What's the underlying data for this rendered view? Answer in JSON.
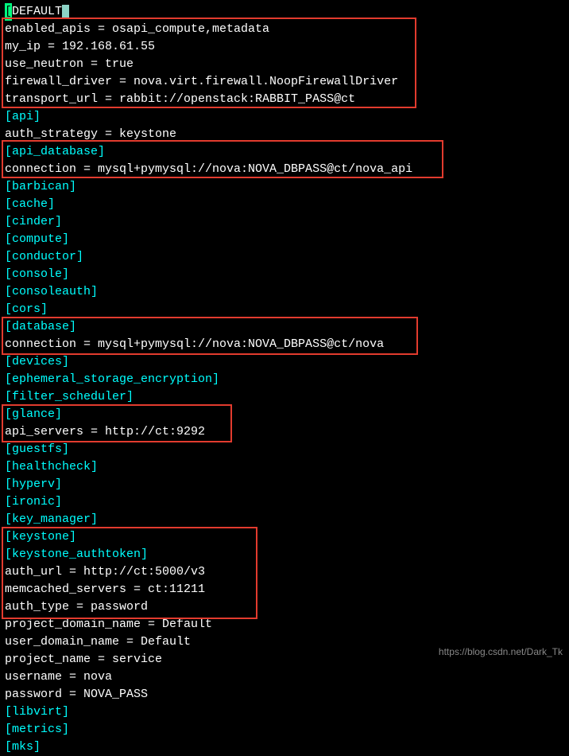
{
  "header": {
    "marker": "[",
    "label": "DEFAULT",
    "marker_end": "]"
  },
  "section_default": [
    "enabled_apis = osapi_compute,metadata",
    "my_ip = 192.168.61.55",
    "use_neutron = true",
    "firewall_driver = nova.virt.firewall.NoopFirewallDriver",
    "transport_url = rabbit://openstack:RABBIT_PASS@ct"
  ],
  "line_api": "[api]",
  "line_auth_strategy": "auth_strategy = keystone",
  "section_api_db": [
    "[api_database]",
    "connection = mysql+pymysql://nova:NOVA_DBPASS@ct/nova_api"
  ],
  "middle_sections": [
    "[barbican]",
    "[cache]",
    "[cinder]",
    "[compute]",
    "[conductor]",
    "[console]",
    "[consoleauth]",
    "[cors]"
  ],
  "section_database": [
    "[database]",
    "connection = mysql+pymysql://nova:NOVA_DBPASS@ct/nova"
  ],
  "middle_sections2": [
    "[devices]",
    "[ephemeral_storage_encryption]",
    "[filter_scheduler]"
  ],
  "section_glance": [
    "[glance]",
    "api_servers = http://ct:9292"
  ],
  "middle_sections3": [
    "[guestfs]",
    "[healthcheck]",
    "[hyperv]",
    "[ironic]",
    "[key_manager]",
    "[keystone]",
    "[keystone_authtoken]"
  ],
  "section_keystone_auth": [
    "auth_url = http://ct:5000/v3",
    "memcached_servers = ct:11211",
    "auth_type = password",
    "project_domain_name = Default",
    "user_domain_name = Default",
    "project_name = service",
    "username = nova",
    "password = NOVA_PASS"
  ],
  "tail_sections": [
    "[libvirt]",
    "[metrics]",
    "[mks]"
  ],
  "watermark": "https://blog.csdn.net/Dark_Tk"
}
